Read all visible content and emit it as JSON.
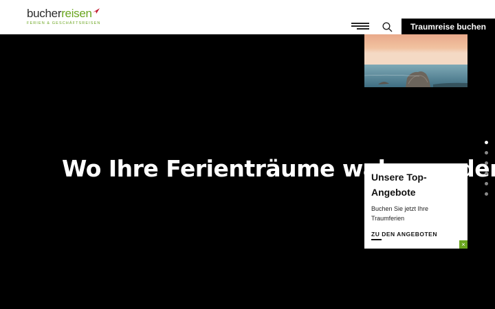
{
  "header": {
    "logo": {
      "part1": "bucher",
      "part2": "reisen",
      "tagline": "FERIEN & GESCHÄFTSREISEN"
    },
    "icons": {
      "menu": "hamburger-menu-icon",
      "search": "search-icon"
    },
    "cta_label": "Traumreise buchen"
  },
  "hero": {
    "headline": "Wo Ihre Ferienträume wahr werden",
    "thumbnail": "coastal-rocks-sunset-image"
  },
  "slider": {
    "dot_count": 6,
    "active_index": 0
  },
  "promo_card": {
    "title": "Unsere Top-Angebote",
    "subtitle": "Buchen Sie jetzt Ihre Traumferien",
    "link_label": "ZU DEN ANGEBOTEN",
    "close_symbol": "×"
  },
  "colors": {
    "brand_green": "#6aa51f",
    "brand_red": "#c0172d",
    "cta_bg": "#000000"
  }
}
